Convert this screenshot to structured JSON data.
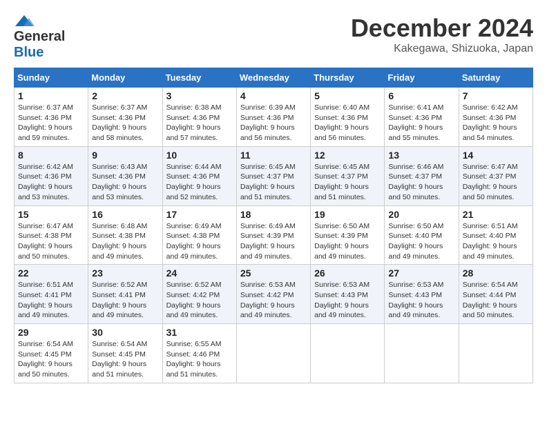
{
  "header": {
    "logo_line1": "General",
    "logo_line2": "Blue",
    "month": "December 2024",
    "location": "Kakegawa, Shizuoka, Japan"
  },
  "weekdays": [
    "Sunday",
    "Monday",
    "Tuesday",
    "Wednesday",
    "Thursday",
    "Friday",
    "Saturday"
  ],
  "weeks": [
    [
      {
        "day": "1",
        "info": "Sunrise: 6:37 AM\nSunset: 4:36 PM\nDaylight: 9 hours and 59 minutes."
      },
      {
        "day": "2",
        "info": "Sunrise: 6:37 AM\nSunset: 4:36 PM\nDaylight: 9 hours and 58 minutes."
      },
      {
        "day": "3",
        "info": "Sunrise: 6:38 AM\nSunset: 4:36 PM\nDaylight: 9 hours and 57 minutes."
      },
      {
        "day": "4",
        "info": "Sunrise: 6:39 AM\nSunset: 4:36 PM\nDaylight: 9 hours and 56 minutes."
      },
      {
        "day": "5",
        "info": "Sunrise: 6:40 AM\nSunset: 4:36 PM\nDaylight: 9 hours and 56 minutes."
      },
      {
        "day": "6",
        "info": "Sunrise: 6:41 AM\nSunset: 4:36 PM\nDaylight: 9 hours and 55 minutes."
      },
      {
        "day": "7",
        "info": "Sunrise: 6:42 AM\nSunset: 4:36 PM\nDaylight: 9 hours and 54 minutes."
      }
    ],
    [
      {
        "day": "8",
        "info": "Sunrise: 6:42 AM\nSunset: 4:36 PM\nDaylight: 9 hours and 53 minutes."
      },
      {
        "day": "9",
        "info": "Sunrise: 6:43 AM\nSunset: 4:36 PM\nDaylight: 9 hours and 53 minutes."
      },
      {
        "day": "10",
        "info": "Sunrise: 6:44 AM\nSunset: 4:36 PM\nDaylight: 9 hours and 52 minutes."
      },
      {
        "day": "11",
        "info": "Sunrise: 6:45 AM\nSunset: 4:37 PM\nDaylight: 9 hours and 51 minutes."
      },
      {
        "day": "12",
        "info": "Sunrise: 6:45 AM\nSunset: 4:37 PM\nDaylight: 9 hours and 51 minutes."
      },
      {
        "day": "13",
        "info": "Sunrise: 6:46 AM\nSunset: 4:37 PM\nDaylight: 9 hours and 50 minutes."
      },
      {
        "day": "14",
        "info": "Sunrise: 6:47 AM\nSunset: 4:37 PM\nDaylight: 9 hours and 50 minutes."
      }
    ],
    [
      {
        "day": "15",
        "info": "Sunrise: 6:47 AM\nSunset: 4:38 PM\nDaylight: 9 hours and 50 minutes."
      },
      {
        "day": "16",
        "info": "Sunrise: 6:48 AM\nSunset: 4:38 PM\nDaylight: 9 hours and 49 minutes."
      },
      {
        "day": "17",
        "info": "Sunrise: 6:49 AM\nSunset: 4:38 PM\nDaylight: 9 hours and 49 minutes."
      },
      {
        "day": "18",
        "info": "Sunrise: 6:49 AM\nSunset: 4:39 PM\nDaylight: 9 hours and 49 minutes."
      },
      {
        "day": "19",
        "info": "Sunrise: 6:50 AM\nSunset: 4:39 PM\nDaylight: 9 hours and 49 minutes."
      },
      {
        "day": "20",
        "info": "Sunrise: 6:50 AM\nSunset: 4:40 PM\nDaylight: 9 hours and 49 minutes."
      },
      {
        "day": "21",
        "info": "Sunrise: 6:51 AM\nSunset: 4:40 PM\nDaylight: 9 hours and 49 minutes."
      }
    ],
    [
      {
        "day": "22",
        "info": "Sunrise: 6:51 AM\nSunset: 4:41 PM\nDaylight: 9 hours and 49 minutes."
      },
      {
        "day": "23",
        "info": "Sunrise: 6:52 AM\nSunset: 4:41 PM\nDaylight: 9 hours and 49 minutes."
      },
      {
        "day": "24",
        "info": "Sunrise: 6:52 AM\nSunset: 4:42 PM\nDaylight: 9 hours and 49 minutes."
      },
      {
        "day": "25",
        "info": "Sunrise: 6:53 AM\nSunset: 4:42 PM\nDaylight: 9 hours and 49 minutes."
      },
      {
        "day": "26",
        "info": "Sunrise: 6:53 AM\nSunset: 4:43 PM\nDaylight: 9 hours and 49 minutes."
      },
      {
        "day": "27",
        "info": "Sunrise: 6:53 AM\nSunset: 4:43 PM\nDaylight: 9 hours and 49 minutes."
      },
      {
        "day": "28",
        "info": "Sunrise: 6:54 AM\nSunset: 4:44 PM\nDaylight: 9 hours and 50 minutes."
      }
    ],
    [
      {
        "day": "29",
        "info": "Sunrise: 6:54 AM\nSunset: 4:45 PM\nDaylight: 9 hours and 50 minutes."
      },
      {
        "day": "30",
        "info": "Sunrise: 6:54 AM\nSunset: 4:45 PM\nDaylight: 9 hours and 51 minutes."
      },
      {
        "day": "31",
        "info": "Sunrise: 6:55 AM\nSunset: 4:46 PM\nDaylight: 9 hours and 51 minutes."
      },
      {
        "day": "",
        "info": ""
      },
      {
        "day": "",
        "info": ""
      },
      {
        "day": "",
        "info": ""
      },
      {
        "day": "",
        "info": ""
      }
    ]
  ]
}
